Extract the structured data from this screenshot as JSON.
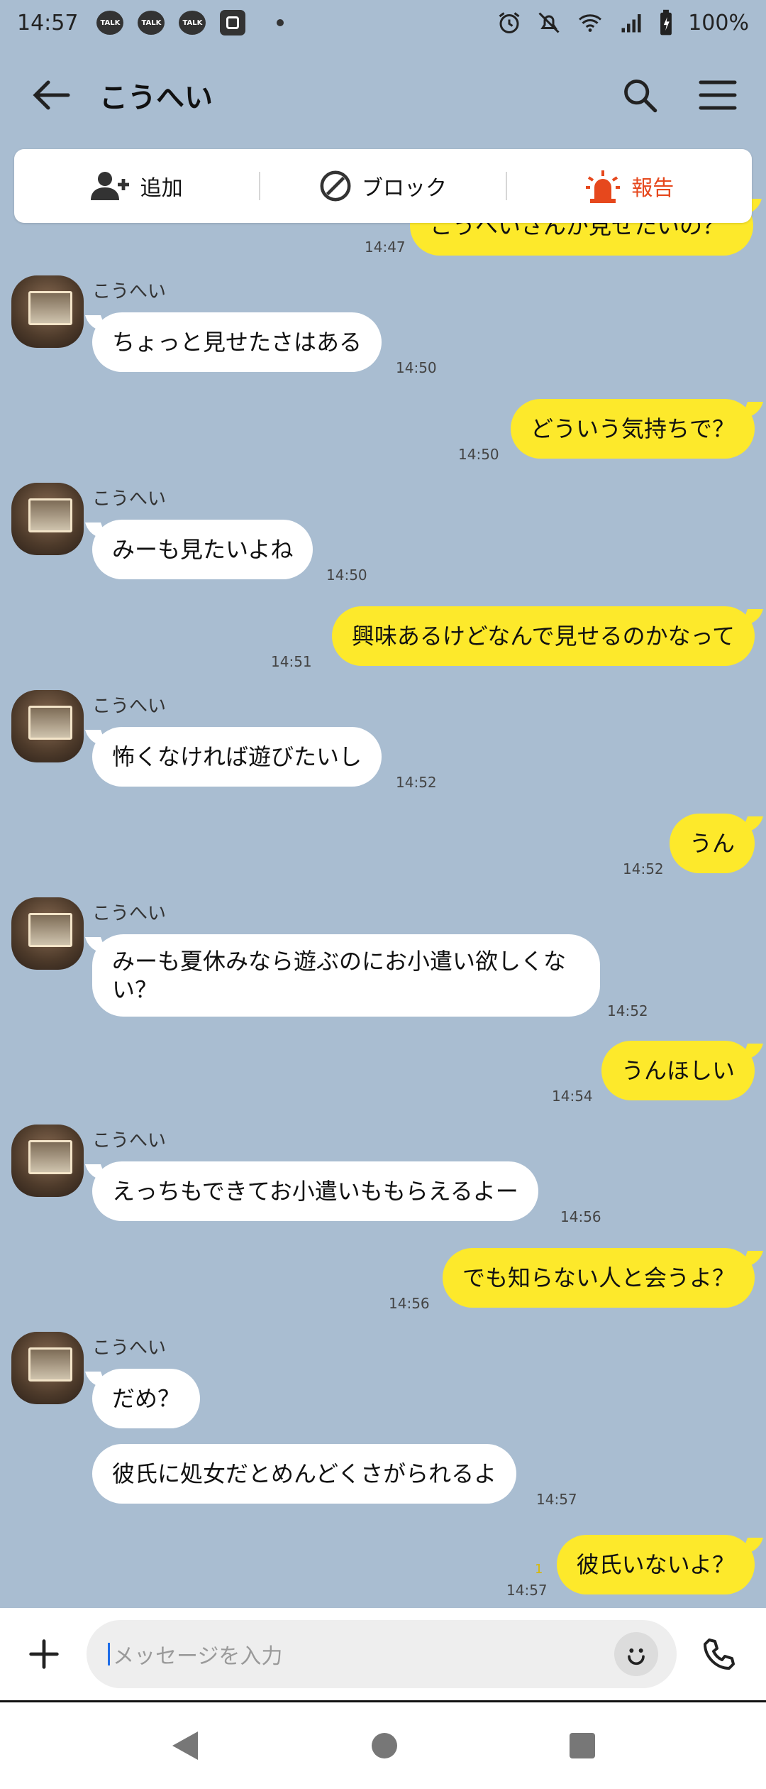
{
  "status_bar": {
    "time": "14:57",
    "badges": [
      "TALK",
      "TALK",
      "TALK"
    ],
    "battery": "100%",
    "wifi_label": "5"
  },
  "header": {
    "title": "こうへい"
  },
  "actions": {
    "add": "追加",
    "block": "ブロック",
    "report": "報告",
    "report_color": "#e6481d"
  },
  "messages": {
    "m0": {
      "text": "こうへいさんが見せたいの？",
      "time": "14:47"
    },
    "m1": {
      "sender": "こうへい",
      "text": "ちょっと見せたさはある",
      "time": "14:50"
    },
    "m2": {
      "text": "どういう気持ちで？",
      "time": "14:50"
    },
    "m3": {
      "sender": "こうへい",
      "text": "みーも見たいよね",
      "time": "14:50"
    },
    "m4": {
      "text": "興味あるけどなんで見せるのかなって",
      "time": "14:51"
    },
    "m5": {
      "sender": "こうへい",
      "text": "怖くなければ遊びたいし",
      "time": "14:52"
    },
    "m6": {
      "text": "うん",
      "time": "14:52"
    },
    "m7": {
      "sender": "こうへい",
      "text": "みーも夏休みなら遊ぶのにお小遣い欲しくない？",
      "time": "14:52"
    },
    "m8": {
      "text": "うんほしい",
      "time": "14:54"
    },
    "m9": {
      "sender": "こうへい",
      "text": "えっちもできてお小遣いももらえるよー",
      "time": "14:56"
    },
    "m10": {
      "text": "でも知らない人と会うよ？",
      "time": "14:56"
    },
    "m11": {
      "sender": "こうへい",
      "text": "だめ？"
    },
    "m12": {
      "text": "彼氏に処女だとめんどくさがられるよ",
      "time": "14:57"
    },
    "m13": {
      "text": "彼氏いないよ？",
      "time": "14:57",
      "read": "1"
    }
  },
  "input": {
    "placeholder": "メッセージを入力"
  },
  "colors": {
    "background": "#a9bdd1",
    "outgoing": "#fde92b",
    "incoming": "#ffffff"
  }
}
